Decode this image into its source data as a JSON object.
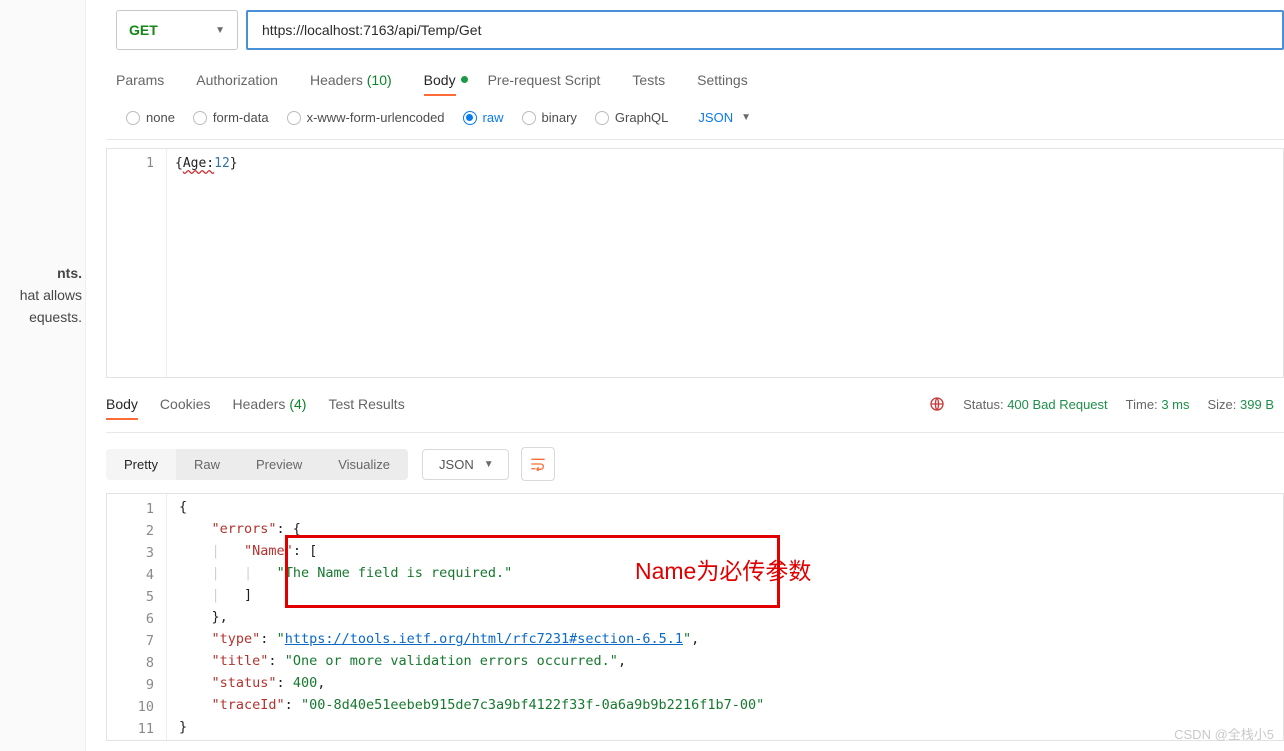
{
  "left": {
    "l1": "nts.",
    "l2": "hat allows",
    "l3": "equests."
  },
  "request": {
    "method": "GET",
    "url": "https://localhost:7163/api/Temp/Get"
  },
  "tabs": {
    "params": "Params",
    "auth": "Authorization",
    "headers_label": "Headers",
    "headers_count": "(10)",
    "body": "Body",
    "prereq": "Pre-request Script",
    "tests": "Tests",
    "settings": "Settings"
  },
  "body_types": {
    "none": "none",
    "form": "form-data",
    "xwww": "x-www-form-urlencoded",
    "raw": "raw",
    "binary": "binary",
    "graphql": "GraphQL",
    "json": "JSON"
  },
  "req_editor": {
    "line1_pre": "{",
    "line1_key": "Age:",
    "line1_val": "12",
    "line1_suf": "}"
  },
  "resp_tabs": {
    "body": "Body",
    "cookies": "Cookies",
    "headers_label": "Headers",
    "headers_count": "(4)",
    "results": "Test Results"
  },
  "resp_meta": {
    "status_label": "Status:",
    "status_val": "400 Bad Request",
    "time_label": "Time:",
    "time_val": "3 ms",
    "size_label": "Size:",
    "size_val": "399 B"
  },
  "view": {
    "pretty": "Pretty",
    "raw": "Raw",
    "preview": "Preview",
    "visualize": "Visualize",
    "json": "JSON"
  },
  "json": {
    "k_errors": "\"errors\"",
    "k_name": "\"Name\"",
    "v_msg": "\"The Name field is required.\"",
    "k_type": "\"type\"",
    "v_type": "\"https://tools.ietf.org/html/rfc7231#section-6.5.1\"",
    "k_title": "\"title\"",
    "v_title": "\"One or more validation errors occurred.\"",
    "k_status": "\"status\"",
    "v_status": "400",
    "k_trace": "\"traceId\"",
    "v_trace": "\"00-8d40e51eebeb915de7c3a9bf4122f33f-0a6a9b9b2216f1b7-00\""
  },
  "annotation": "Name为必传参数",
  "watermark": "CSDN @全栈小5"
}
